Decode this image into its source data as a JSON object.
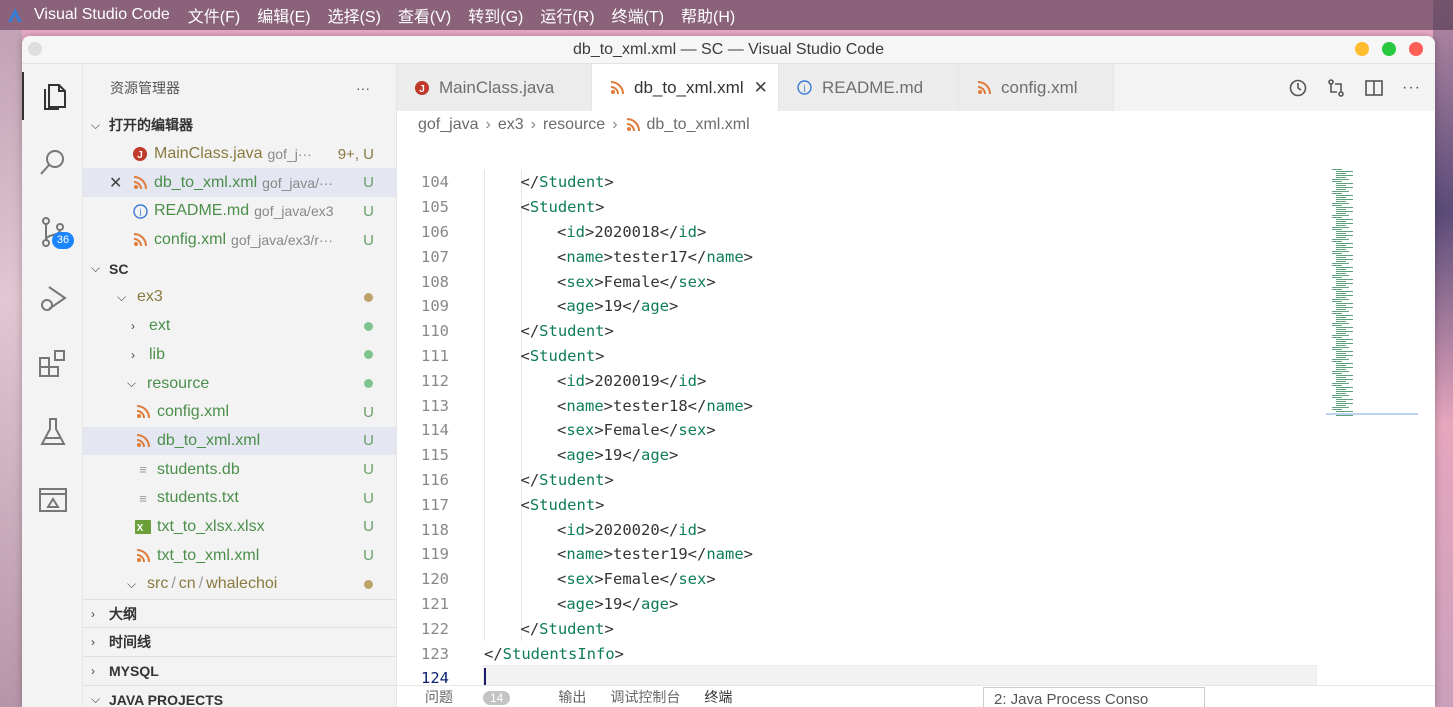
{
  "menubar": {
    "app_name": "Visual Studio Code",
    "items": [
      "文件(F)",
      "编辑(E)",
      "选择(S)",
      "查看(V)",
      "转到(G)",
      "运行(R)",
      "终端(T)",
      "帮助(H)"
    ]
  },
  "window": {
    "title": "db_to_xml.xml — SC — Visual Studio Code"
  },
  "activity": {
    "scm_badge": "36"
  },
  "sidebar": {
    "title": "资源管理器",
    "more": "···",
    "open_editors_title": "打开的编辑器",
    "open_editors": [
      {
        "name": "MainClass.java",
        "path": "gof_j···",
        "status": "9+, U",
        "icon": "java-icon"
      },
      {
        "name": "db_to_xml.xml",
        "path": "gof_java/···",
        "status": "U",
        "icon": "rss-icon",
        "close": "✕"
      },
      {
        "name": "README.md",
        "path": "gof_java/ex3",
        "status": "U",
        "icon": "info-icon"
      },
      {
        "name": "config.xml",
        "path": "gof_java/ex3/r···",
        "status": "U",
        "icon": "rss-icon"
      }
    ],
    "workspace_title": "SC",
    "tree": {
      "ex3": "ex3",
      "ext": "ext",
      "lib": "lib",
      "resource": "resource",
      "files": [
        {
          "name": "config.xml",
          "status": "U",
          "icon": "rss-icon"
        },
        {
          "name": "db_to_xml.xml",
          "status": "U",
          "icon": "rss-icon"
        },
        {
          "name": "students.db",
          "status": "U",
          "icon": "lines-icon"
        },
        {
          "name": "students.txt",
          "status": "U",
          "icon": "lines-icon"
        },
        {
          "name": "txt_to_xlsx.xlsx",
          "status": "U",
          "icon": "excel-icon"
        },
        {
          "name": "txt_to_xml.xml",
          "status": "U",
          "icon": "rss-icon"
        }
      ],
      "src_path": [
        "src",
        "cn",
        "whalechoi"
      ]
    },
    "outline_title": "大纲",
    "timeline_title": "时间线",
    "mysql_title": "MYSQL",
    "java_projects_title": "JAVA PROJECTS"
  },
  "tabs": [
    {
      "label": "MainClass.java",
      "icon": "java-icon"
    },
    {
      "label": "db_to_xml.xml",
      "icon": "rss-icon",
      "close": "✕"
    },
    {
      "label": "README.md",
      "icon": "info-icon"
    },
    {
      "label": "config.xml",
      "icon": "rss-icon"
    }
  ],
  "breadcrumb": [
    "gof_java",
    "ex3",
    "resource",
    "db_to_xml.xml"
  ],
  "editor": {
    "lines": [
      {
        "n": "104",
        "indent": 1,
        "kind": "close",
        "tag": "Student"
      },
      {
        "n": "105",
        "indent": 1,
        "kind": "open",
        "tag": "Student"
      },
      {
        "n": "106",
        "indent": 2,
        "kind": "elem",
        "tag": "id",
        "text": "2020018"
      },
      {
        "n": "107",
        "indent": 2,
        "kind": "elem",
        "tag": "name",
        "text": "tester17"
      },
      {
        "n": "108",
        "indent": 2,
        "kind": "elem",
        "tag": "sex",
        "text": "Female"
      },
      {
        "n": "109",
        "indent": 2,
        "kind": "elem",
        "tag": "age",
        "text": "19"
      },
      {
        "n": "110",
        "indent": 1,
        "kind": "close",
        "tag": "Student"
      },
      {
        "n": "111",
        "indent": 1,
        "kind": "open",
        "tag": "Student"
      },
      {
        "n": "112",
        "indent": 2,
        "kind": "elem",
        "tag": "id",
        "text": "2020019"
      },
      {
        "n": "113",
        "indent": 2,
        "kind": "elem",
        "tag": "name",
        "text": "tester18"
      },
      {
        "n": "114",
        "indent": 2,
        "kind": "elem",
        "tag": "sex",
        "text": "Female"
      },
      {
        "n": "115",
        "indent": 2,
        "kind": "elem",
        "tag": "age",
        "text": "19"
      },
      {
        "n": "116",
        "indent": 1,
        "kind": "close",
        "tag": "Student"
      },
      {
        "n": "117",
        "indent": 1,
        "kind": "open",
        "tag": "Student"
      },
      {
        "n": "118",
        "indent": 2,
        "kind": "elem",
        "tag": "id",
        "text": "2020020"
      },
      {
        "n": "119",
        "indent": 2,
        "kind": "elem",
        "tag": "name",
        "text": "tester19"
      },
      {
        "n": "120",
        "indent": 2,
        "kind": "elem",
        "tag": "sex",
        "text": "Female"
      },
      {
        "n": "121",
        "indent": 2,
        "kind": "elem",
        "tag": "age",
        "text": "19"
      },
      {
        "n": "122",
        "indent": 1,
        "kind": "close",
        "tag": "Student"
      },
      {
        "n": "123",
        "indent": 0,
        "kind": "close",
        "tag": "StudentsInfo"
      },
      {
        "n": "124",
        "indent": 0,
        "kind": "empty",
        "current": true
      }
    ]
  },
  "panel": {
    "tabs": [
      "问题",
      "输出",
      "调试控制台",
      "终端"
    ],
    "problems_count": "14",
    "terminal_select": "2: Java Process Conso"
  },
  "colors": {
    "tag": "#0e7d55",
    "untracked": "#8a7a3f",
    "added": "#4b8f4b",
    "badge": "#1a85ff",
    "close_red": "#ff5f57",
    "minimize_yellow": "#febc2e",
    "zoom_green": "#28c840"
  }
}
